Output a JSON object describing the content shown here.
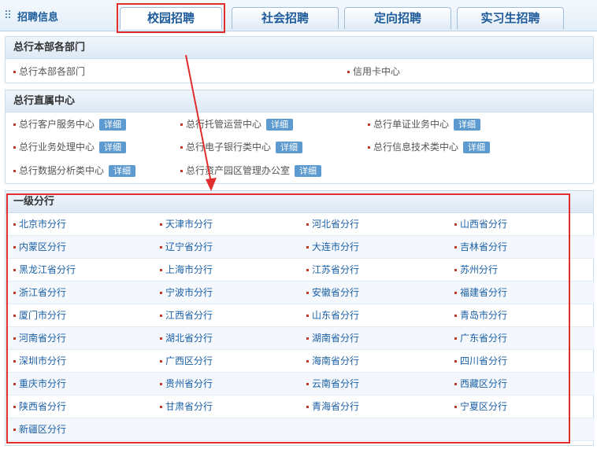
{
  "header": {
    "brand": "招聘信息",
    "tabs": [
      {
        "label": "校园招聘"
      },
      {
        "label": "社会招聘"
      },
      {
        "label": "定向招聘"
      },
      {
        "label": "实习生招聘"
      }
    ]
  },
  "sections": {
    "hq_departments": {
      "title": "总行本部各部门",
      "items": [
        "总行本部各部门",
        "信用卡中心"
      ]
    },
    "direct_centers": {
      "title": "总行直属中心",
      "detail_label": "详细",
      "items": [
        "总行客户服务中心",
        "总行托管运营中心",
        "总行单证业务中心",
        "总行业务处理中心",
        "总行电子银行类中心",
        "总行信息技术类中心",
        "总行数据分析类中心",
        "总行资产园区管理办公室"
      ]
    },
    "branches": {
      "title": "一级分行",
      "items": [
        "北京市分行",
        "天津市分行",
        "河北省分行",
        "山西省分行",
        "内蒙区分行",
        "辽宁省分行",
        "大连市分行",
        "吉林省分行",
        "黑龙江省分行",
        "上海市分行",
        "江苏省分行",
        "苏州分行",
        "浙江省分行",
        "宁波市分行",
        "安徽省分行",
        "福建省分行",
        "厦门市分行",
        "江西省分行",
        "山东省分行",
        "青岛市分行",
        "河南省分行",
        "湖北省分行",
        "湖南省分行",
        "广东省分行",
        "深圳市分行",
        "广西区分行",
        "海南省分行",
        "四川省分行",
        "重庆市分行",
        "贵州省分行",
        "云南省分行",
        "西藏区分行",
        "陕西省分行",
        "甘肃省分行",
        "青海省分行",
        "宁夏区分行",
        "新疆区分行"
      ]
    }
  },
  "colors": {
    "link": "#1a5fa6",
    "highlight": "#e02d2d",
    "detail_badge": "#5d9ad0"
  }
}
